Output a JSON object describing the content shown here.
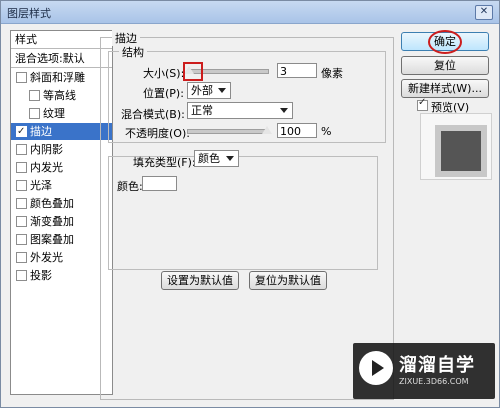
{
  "window": {
    "title": "图层样式",
    "close_symbol": "✕"
  },
  "sidebar": {
    "header": "样式",
    "blend_label": "混合选项:默认",
    "items": [
      {
        "label": "斜面和浮雕",
        "checked": false,
        "selected": false,
        "indent": false
      },
      {
        "label": "等高线",
        "checked": false,
        "selected": false,
        "indent": true
      },
      {
        "label": "纹理",
        "checked": false,
        "selected": false,
        "indent": true
      },
      {
        "label": "描边",
        "checked": true,
        "selected": true,
        "indent": false
      },
      {
        "label": "内阴影",
        "checked": false,
        "selected": false,
        "indent": false
      },
      {
        "label": "内发光",
        "checked": false,
        "selected": false,
        "indent": false
      },
      {
        "label": "光泽",
        "checked": false,
        "selected": false,
        "indent": false
      },
      {
        "label": "颜色叠加",
        "checked": false,
        "selected": false,
        "indent": false
      },
      {
        "label": "渐变叠加",
        "checked": false,
        "selected": false,
        "indent": false
      },
      {
        "label": "图案叠加",
        "checked": false,
        "selected": false,
        "indent": false
      },
      {
        "label": "外发光",
        "checked": false,
        "selected": false,
        "indent": false
      },
      {
        "label": "投影",
        "checked": false,
        "selected": false,
        "indent": false
      }
    ]
  },
  "stroke": {
    "group_title": "描边",
    "structure_title": "结构",
    "size_label": "大小(S):",
    "size_value": "3",
    "size_unit": "像素",
    "size_fraction": 0.02,
    "position_label": "位置(P):",
    "position_value": "外部",
    "blend_mode_label": "混合模式(B):",
    "blend_mode_value": "正常",
    "opacity_label": "不透明度(O):",
    "opacity_value": "100",
    "opacity_unit": "%",
    "opacity_fraction": 1.0,
    "fill_type_label": "填充类型(F):",
    "fill_type_value": "颜色",
    "color_label": "颜色:",
    "color_swatch": "#ffffff",
    "default_button": "设置为默认值",
    "reset_button": "复位为默认值"
  },
  "buttons": {
    "ok": "确定",
    "reset": "复位",
    "new_style": "新建样式(W)...",
    "preview_label": "预览(V)",
    "preview_checked": true
  },
  "watermark": {
    "brand": "溜溜自学",
    "url": "ZIXUE.3D66.COM"
  },
  "colors": {
    "selection": "#3a73c9",
    "highlight": "#cc1d1d",
    "preview_fill": "#555555"
  }
}
